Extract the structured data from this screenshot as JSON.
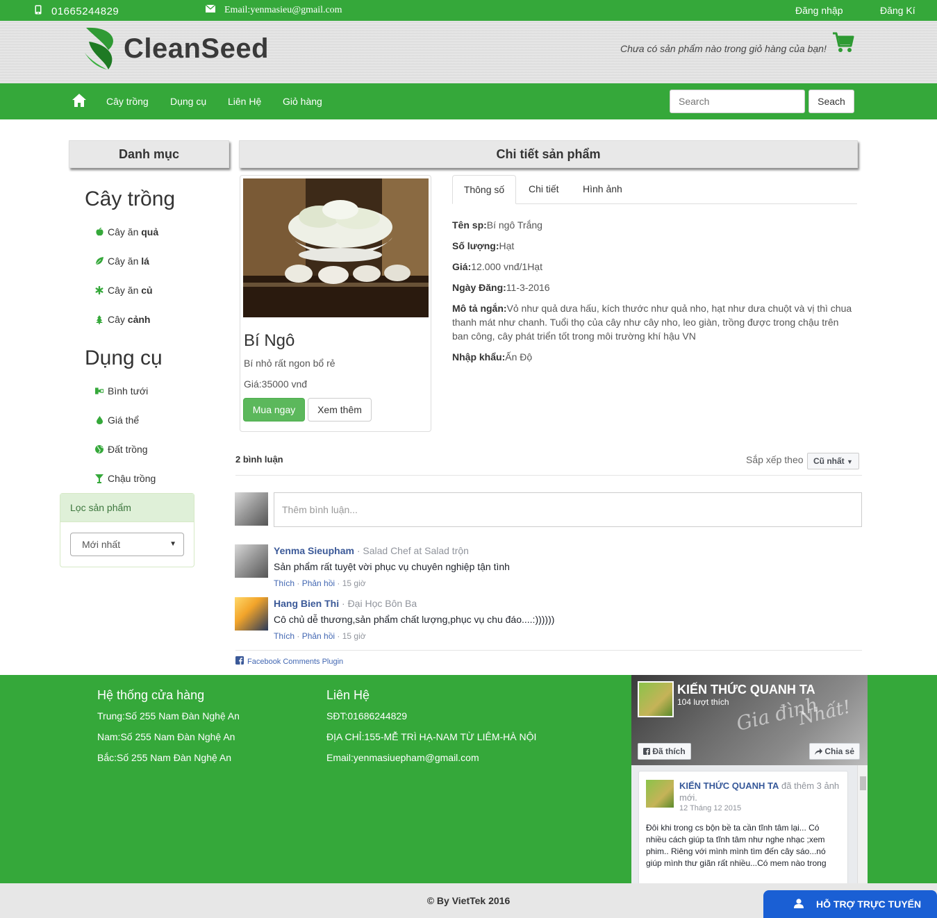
{
  "topbar": {
    "phone": "01665244829",
    "email": "Email:yenmasieu@gmail.com",
    "login": "Đăng nhập",
    "register": "Đăng Kí"
  },
  "header": {
    "brand": "CleanSeed",
    "cart_text": "Chưa có sản phẩm nào trong giỏ hàng của bạn!"
  },
  "nav": {
    "items": [
      "Cây trồng",
      "Dụng cụ",
      "Liên Hệ",
      "Giỏ hàng"
    ],
    "search_placeholder": "Search",
    "search_button": "Seach"
  },
  "sidebar": {
    "heading": "Danh mục",
    "groups": [
      {
        "title": "Cây trồng",
        "items": [
          {
            "prefix": "Cây ăn ",
            "bold": "quả",
            "icon": "apple-icon"
          },
          {
            "prefix": "Cây ăn ",
            "bold": "lá",
            "icon": "leaf-icon"
          },
          {
            "prefix": "Cây ăn ",
            "bold": "củ",
            "icon": "asterisk-icon"
          },
          {
            "prefix": "Cây ",
            "bold": "cảnh",
            "icon": "tree-icon"
          }
        ]
      },
      {
        "title": "Dụng cụ",
        "items": [
          {
            "label": "Bình tưới",
            "icon": "watering-can-icon"
          },
          {
            "label": "Giá thể",
            "icon": "drop-icon"
          },
          {
            "label": "Đất trồng",
            "icon": "globe-icon"
          },
          {
            "label": "Chậu trồng",
            "icon": "pot-icon"
          }
        ]
      }
    ],
    "filter": {
      "heading": "Lọc sản phẩm",
      "selected": "Mới nhất"
    }
  },
  "detail": {
    "heading": "Chi tiết sản phẩm",
    "card": {
      "name": "Bí Ngô",
      "desc": "Bí nhỏ rất ngon bổ rẻ",
      "price": "Giá:35000 vnđ",
      "buy": "Mua ngay",
      "more": "Xem thêm"
    },
    "tabs": [
      "Thông số",
      "Chi tiết",
      "Hình ảnh"
    ],
    "specs": [
      {
        "label": "Tên sp:",
        "value": "Bí ngô Trắng"
      },
      {
        "label": "Số lượng:",
        "value": "Hạt"
      },
      {
        "label": "Giá:",
        "value": "12.000 vnđ/1Hạt"
      },
      {
        "label": "Ngày Đăng:",
        "value": "11-3-2016"
      },
      {
        "label": "Mô tả ngắn:",
        "value": "Vỏ như quả dưa hấu, kích thước như quả nho, hạt như dưa chuột và vị thì chua thanh mát như chanh. Tuổi thọ của cây như cây nho, leo giàn, trồng được trong chậu trên ban công, cây phát triển tốt trong môi trường khí hậu VN"
      },
      {
        "label": "Nhập khẩu:",
        "value": "Ấn Độ"
      }
    ]
  },
  "comments": {
    "count": "2 bình luận",
    "sort_label": "Sắp xếp theo",
    "sort_value": "Cũ nhất",
    "input_placeholder": "Thêm bình luận...",
    "list": [
      {
        "author": "Yenma Sieupham",
        "role": " · Salad Chef at Salad trộn",
        "text": "Sản phẩm rất tuyệt vời phục vụ chuyên nghiệp tận tình",
        "like": "Thích",
        "reply": "Phản hồi",
        "time": "15 giờ"
      },
      {
        "author": "Hang Bien Thi",
        "role": " · Đại Học Bôn Ba",
        "text": "Cô chủ dễ thương,sản phẩm chất lượng,phục vụ chu đáo....:))))))",
        "like": "Thích",
        "reply": "Phản hồi",
        "time": "15 giờ"
      }
    ],
    "plugin": "Facebook Comments Plugin"
  },
  "footer": {
    "stores_title": "Hệ thống cửa hàng",
    "stores": [
      "Trung:Số 255 Nam Đàn Nghệ An",
      "Nam:Số 255 Nam Đàn Nghệ An",
      "Bắc:Số 255 Nam Đàn Nghệ An"
    ],
    "contact_title": "Liên Hệ",
    "contact": [
      "SĐT:01686244829",
      "ĐỊA CHỈ:155-MỄ TRÌ HẠ-NAM TỪ LIÊM-HÀ NỘI",
      "Email:yenmasiuepham@gmail.com"
    ],
    "fb": {
      "page_name": "KIẾN THỨC QUANH TA",
      "likes": "104 lượt thích",
      "like_btn": "Đã thích",
      "share_btn": "Chia sẻ",
      "post_author": "KIẾN THỨC QUANH TA",
      "post_action": " đã thêm 3 ảnh mới.",
      "post_date": "12 Tháng 12 2015",
      "post_text": "Đôi khi trong cs bộn bề ta cần tĩnh tâm lại... Có nhiều cách giúp ta tĩnh tâm như nghe nhạc ;xem phim.. Riêng với mình mình tìm đến cây sáo...nó giúp mình thư giãn rất nhiều...Có mem nào trong"
    },
    "copyright": "© By VietTek 2016",
    "support": "HỖ TRỢ TRỰC TUYẾN"
  }
}
